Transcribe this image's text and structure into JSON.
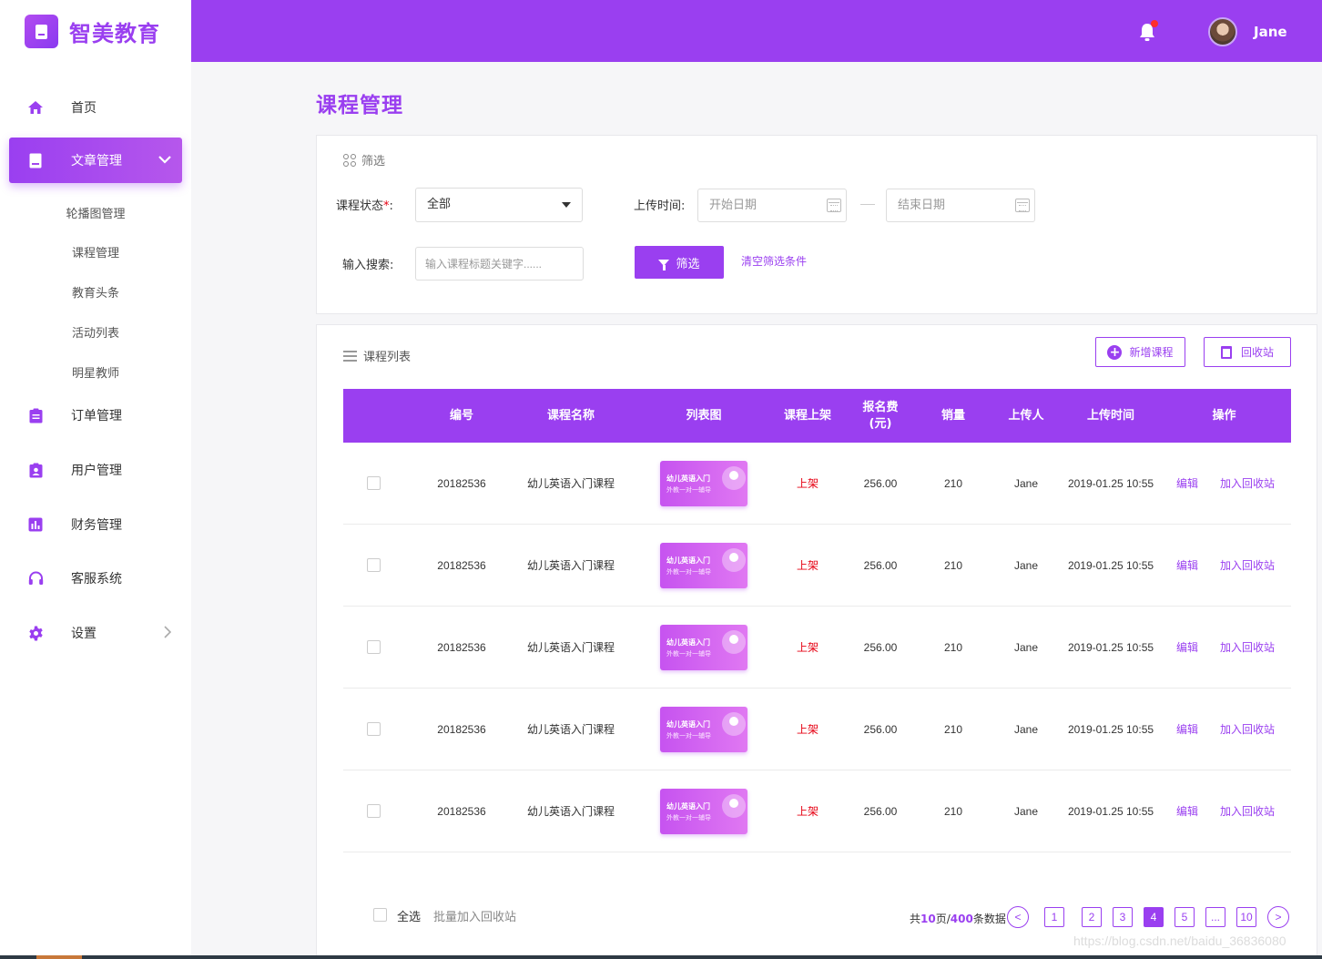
{
  "brand": {
    "name": "智美教育"
  },
  "sidebar": {
    "items": [
      {
        "label": "首页",
        "icon": "home-icon"
      },
      {
        "label": "文章管理",
        "icon": "book-icon",
        "active": true
      },
      {
        "label": "订单管理",
        "icon": "clipboard-icon"
      },
      {
        "label": "用户管理",
        "icon": "user-badge-icon"
      },
      {
        "label": "财务管理",
        "icon": "chart-icon"
      },
      {
        "label": "客服系统",
        "icon": "headset-icon"
      },
      {
        "label": "设置",
        "icon": "gear-icon"
      }
    ],
    "sub_items": [
      "轮播图管理",
      "课程管理",
      "教育头条",
      "活动列表",
      "明星教师"
    ]
  },
  "header": {
    "username": "Jane",
    "notification_icon": "bell-icon"
  },
  "page_title": "课程管理",
  "filter": {
    "title": "筛选",
    "status_label": "课程状态",
    "status_required": "*",
    "status_colon": ":",
    "status_value": "全部",
    "upload_time_label": "上传时间:",
    "start_placeholder": "开始日期",
    "end_placeholder": "结束日期",
    "search_label": "输入搜索:",
    "search_placeholder": "输入课程标题关键字......",
    "filter_button": "筛选",
    "clear_link": "清空筛选条件"
  },
  "list": {
    "title": "课程列表",
    "add_button": "新增课程",
    "recycle_button": "回收站",
    "columns": [
      "编号",
      "课程名称",
      "列表图",
      "课程上架",
      "报名费\n(元)",
      "销量",
      "上传人",
      "上传时间",
      "操作"
    ],
    "rows": [
      {
        "id": "20182536",
        "name": "幼儿英语入门课程",
        "thumb_title": "幼儿英语入门",
        "thumb_sub": "外教一对一辅导",
        "status": "上架",
        "fee": "256.00",
        "sales": "210",
        "uploader": "Jane",
        "time": "2019-01.25 10:55",
        "edit": "编辑",
        "recycle": "加入回收站"
      },
      {
        "id": "20182536",
        "name": "幼儿英语入门课程",
        "thumb_title": "幼儿英语入门",
        "thumb_sub": "外教一对一辅导",
        "status": "上架",
        "fee": "256.00",
        "sales": "210",
        "uploader": "Jane",
        "time": "2019-01.25 10:55",
        "edit": "编辑",
        "recycle": "加入回收站"
      },
      {
        "id": "20182536",
        "name": "幼儿英语入门课程",
        "thumb_title": "幼儿英语入门",
        "thumb_sub": "外教一对一辅导",
        "status": "上架",
        "fee": "256.00",
        "sales": "210",
        "uploader": "Jane",
        "time": "2019-01.25 10:55",
        "edit": "编辑",
        "recycle": "加入回收站"
      },
      {
        "id": "20182536",
        "name": "幼儿英语入门课程",
        "thumb_title": "幼儿英语入门",
        "thumb_sub": "外教一对一辅导",
        "status": "上架",
        "fee": "256.00",
        "sales": "210",
        "uploader": "Jane",
        "time": "2019-01.25 10:55",
        "edit": "编辑",
        "recycle": "加入回收站"
      },
      {
        "id": "20182536",
        "name": "幼儿英语入门课程",
        "thumb_title": "幼儿英语入门",
        "thumb_sub": "外教一对一辅导",
        "status": "上架",
        "fee": "256.00",
        "sales": "210",
        "uploader": "Jane",
        "time": "2019-01.25 10:55",
        "edit": "编辑",
        "recycle": "加入回收站"
      }
    ],
    "select_all": "全选",
    "batch_recycle": "批量加入回收站"
  },
  "pagination": {
    "prefix": "共",
    "total_pages": "10",
    "pages_unit": "页/",
    "total_items": "400",
    "items_unit": "条数据",
    "prev": "<",
    "pages": [
      "1",
      "2",
      "3",
      "4",
      "5",
      "...",
      "10"
    ],
    "current": "4",
    "next": ">"
  },
  "watermark": "https://blog.csdn.net/baidu_36836080",
  "colors": {
    "accent": "#9a3ff0",
    "status_red": "#e60012",
    "notification_dot": "#ff2d2d"
  }
}
